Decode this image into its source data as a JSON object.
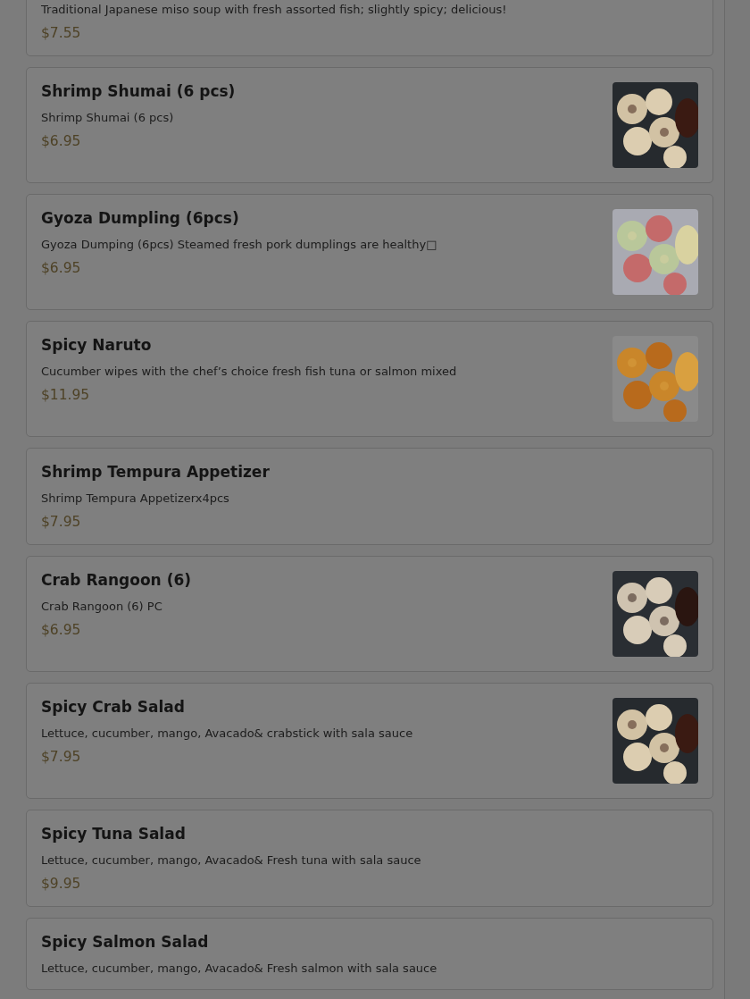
{
  "items": [
    {
      "description": "Traditional Japanese miso soup with fresh assorted fish; slightly spicy; delicious!",
      "price": "$7.55"
    },
    {
      "title": "Shrimp Shumai (6 pcs)",
      "description": "Shrimp Shumai (6 pcs)",
      "price": "$6.95"
    },
    {
      "title": "Gyoza Dumpling (6pcs)",
      "description": "Gyoza Dumping (6pcs) Steamed fresh pork dumplings are healthy□",
      "price": "$6.95"
    },
    {
      "title": "Spicy Naruto",
      "description": "Cucumber wipes with the chef’s choice fresh fish tuna or salmon mixed",
      "price": "$11.95"
    },
    {
      "title": "Shrimp Tempura Appetizer",
      "description": "Shrimp Tempura Appetizerx4pcs",
      "price": "$7.95"
    },
    {
      "title": "Crab Rangoon (6)",
      "description": "Crab Rangoon (6) PC",
      "price": "$6.95"
    },
    {
      "title": "Spicy Crab Salad",
      "description": "Lettuce, cucumber, mango, Avacado& crabstick with sala sauce",
      "price": "$7.95"
    },
    {
      "title": "Spicy Tuna Salad",
      "description": "Lettuce, cucumber, mango, Avacado& Fresh tuna with sala sauce",
      "price": "$9.95"
    },
    {
      "title": "Spicy Salmon Salad",
      "description": "Lettuce, cucumber, mango, Avacado& Fresh salmon with sala sauce"
    }
  ]
}
